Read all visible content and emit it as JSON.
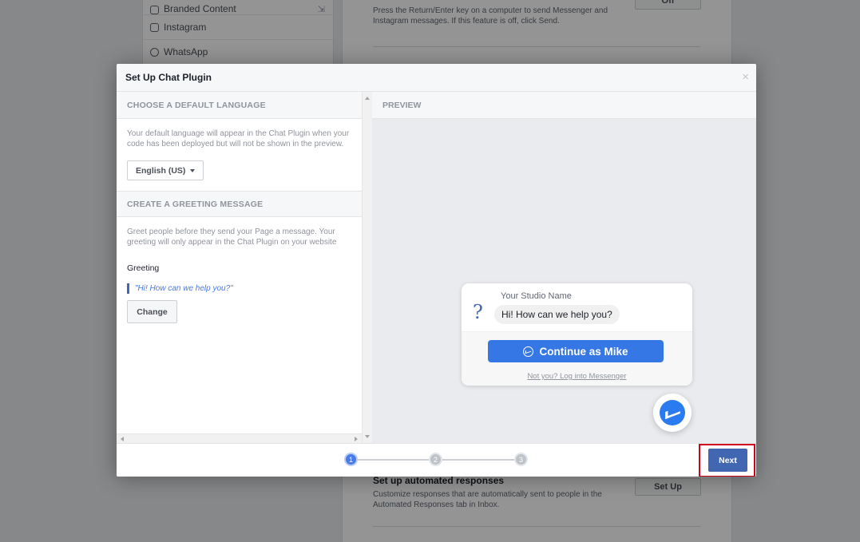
{
  "background": {
    "left_menu": [
      {
        "label": "Branded Content",
        "icon": "branded-content-icon"
      },
      {
        "label": "Instagram",
        "icon": "instagram-icon"
      },
      {
        "label": "WhatsApp",
        "icon": "whatsapp-icon"
      }
    ],
    "send_setting_text": "Press the Return/Enter key on a computer to send Messenger and Instagram messages. If this feature is off, click Send.",
    "send_setting_button": "Off",
    "automated_title": "Set up automated responses",
    "automated_text": "Customize responses that are automatically sent to people in the Automated Responses tab in Inbox.",
    "automated_button": "Set Up"
  },
  "modal": {
    "title": "Set Up Chat Plugin",
    "close_glyph": "×",
    "language_section": {
      "heading": "CHOOSE A DEFAULT LANGUAGE",
      "helper": "Your default language will appear in the Chat Plugin when your code has been deployed but will not be shown in the preview.",
      "selected": "English (US)"
    },
    "greeting_section": {
      "heading": "CREATE A GREETING MESSAGE",
      "helper": "Greet people before they send your Page a message. Your greeting will only appear in the Chat Plugin on your website",
      "label": "Greeting",
      "value": "\"Hi! How can we help you?\"",
      "change_button": "Change"
    },
    "preview": {
      "heading": "PREVIEW",
      "studio_name": "Your Studio Name",
      "avatar_glyph": "?",
      "greeting_bubble": "Hi! How can we help you?",
      "continue_button": "Continue as Mike",
      "not_you_link": "Not you? Log into Messenger"
    },
    "footer": {
      "steps": [
        "1",
        "2",
        "3"
      ],
      "current_step": 1,
      "next_button": "Next"
    }
  },
  "colors": {
    "primary": "#4267b2",
    "messenger_blue": "#3578e5",
    "highlight_red": "#d0021b"
  }
}
